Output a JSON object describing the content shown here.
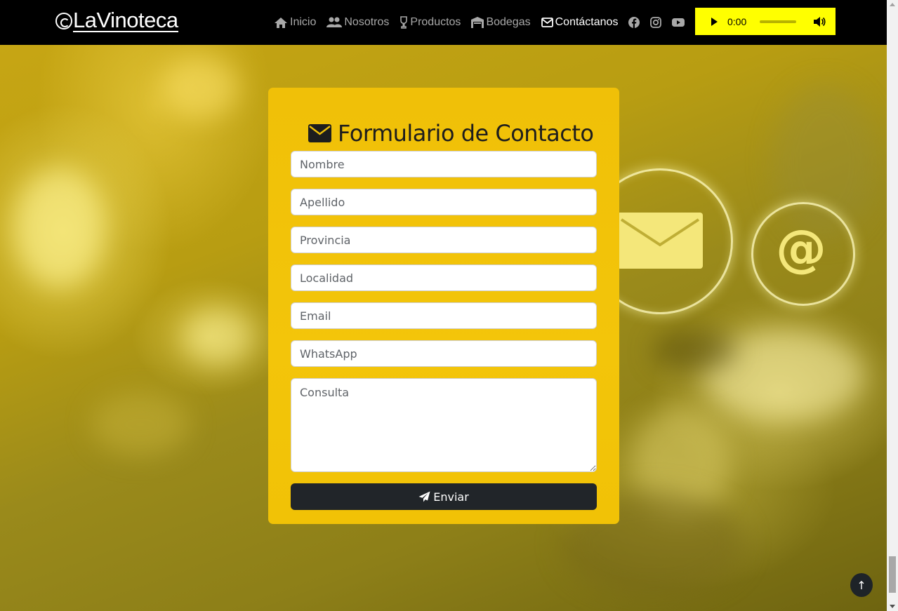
{
  "brand": {
    "name": "LaVinoteca"
  },
  "nav": {
    "items": [
      {
        "label": "Inicio",
        "icon": "home-icon"
      },
      {
        "label": "Nosotros",
        "icon": "users-icon"
      },
      {
        "label": "Productos",
        "icon": "wine-glass-icon"
      },
      {
        "label": "Bodegas",
        "icon": "warehouse-icon"
      },
      {
        "label": "Contáctanos",
        "icon": "envelope-icon",
        "active": true
      }
    ],
    "social": [
      "facebook-icon",
      "instagram-icon",
      "youtube-icon"
    ]
  },
  "audio": {
    "time": "0:00",
    "background": "#ffff00"
  },
  "form": {
    "title": "Formulario de Contacto",
    "fields": {
      "nombre": "Nombre",
      "apellido": "Apellido",
      "provincia": "Provincia",
      "localidad": "Localidad",
      "email": "Email",
      "whatsapp": "WhatsApp",
      "consulta": "Consulta"
    },
    "submit_label": "Enviar",
    "card_color": "#f0c008",
    "button_color": "#212529"
  },
  "back_to_top": {
    "label": "↑"
  }
}
